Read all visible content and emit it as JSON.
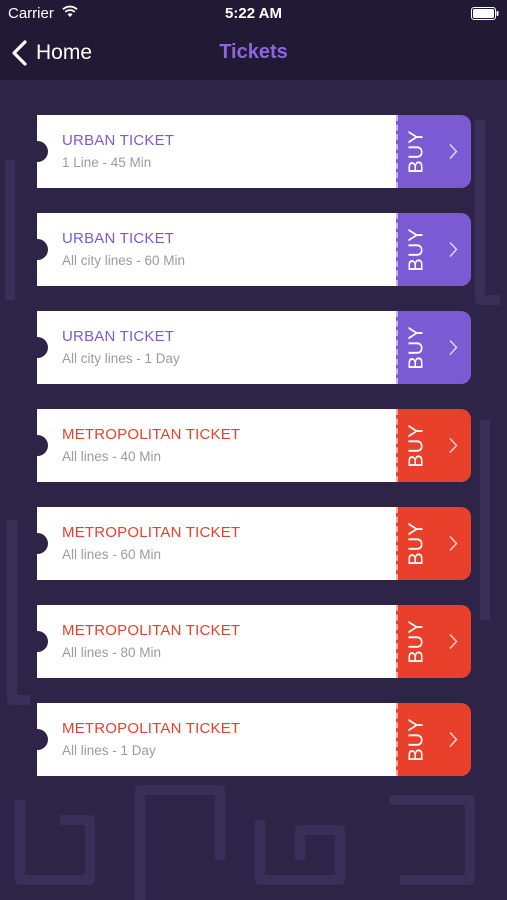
{
  "status_bar": {
    "carrier": "Carrier",
    "time": "5:22 AM"
  },
  "nav": {
    "back_label": "Home",
    "title": "Tickets"
  },
  "colors": {
    "urban": "#7a5bd3",
    "metro": "#e8402a",
    "background": "#2e2447",
    "bar": "#211a35"
  },
  "tickets": [
    {
      "name": "URBAN TICKET",
      "desc": "1 Line - 45 Min",
      "buy": "BUY",
      "kind": "urban"
    },
    {
      "name": "URBAN TICKET",
      "desc": "All city lines - 60 Min",
      "buy": "BUY",
      "kind": "urban"
    },
    {
      "name": "URBAN TICKET",
      "desc": "All city lines - 1 Day",
      "buy": "BUY",
      "kind": "urban"
    },
    {
      "name": "METROPOLITAN TICKET",
      "desc": "All lines - 40 Min",
      "buy": "BUY",
      "kind": "metro"
    },
    {
      "name": "METROPOLITAN TICKET",
      "desc": "All lines - 60 Min",
      "buy": "BUY",
      "kind": "metro"
    },
    {
      "name": "METROPOLITAN TICKET",
      "desc": "All lines - 80 Min",
      "buy": "BUY",
      "kind": "metro"
    },
    {
      "name": "METROPOLITAN TICKET",
      "desc": "All lines - 1 Day",
      "buy": "BUY",
      "kind": "metro"
    }
  ]
}
